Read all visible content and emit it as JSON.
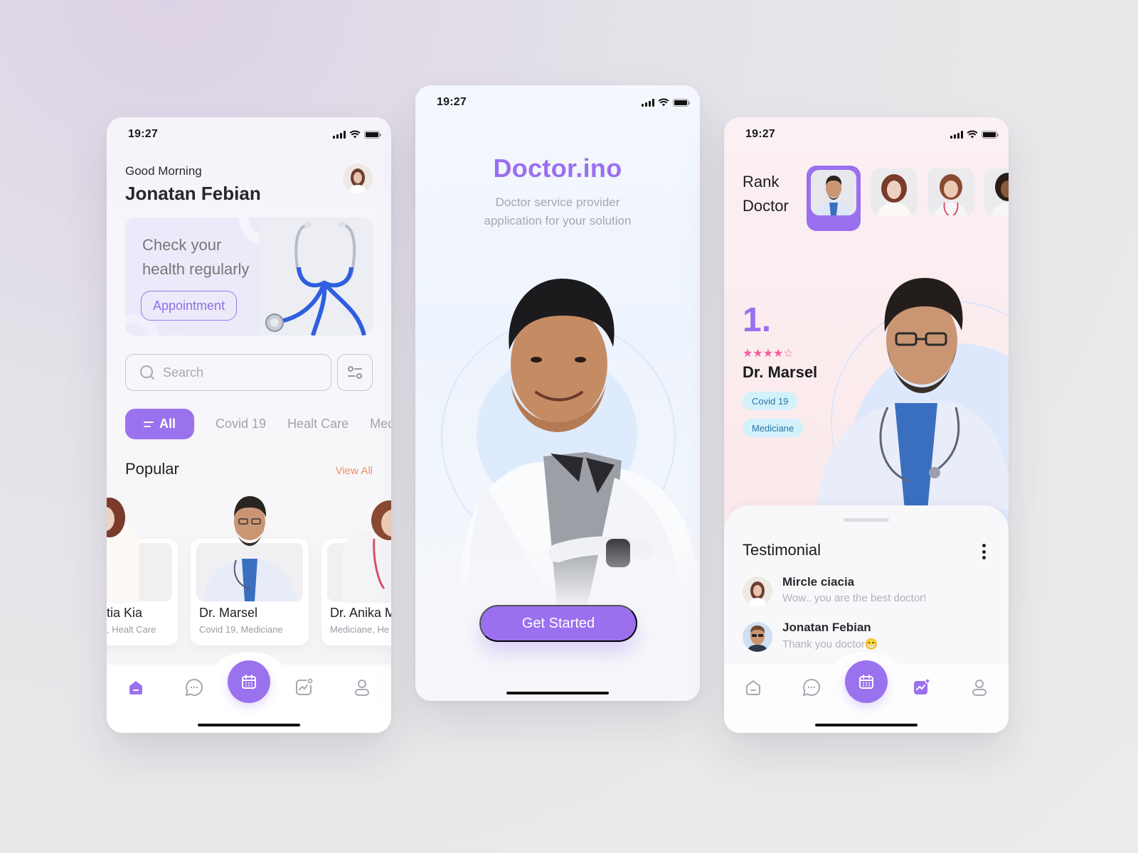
{
  "status_bar": {
    "time": "19:27"
  },
  "colors": {
    "accent": "#9B72EE",
    "view_all": "#F09060",
    "star": "#F2609E",
    "tag_bg": "#D3F1FB",
    "tag_text": "#2874A6"
  },
  "home_screen": {
    "greeting": "Good Morning",
    "user_name": "Jonatan Febian",
    "avatar_icon": "user-avatar",
    "banner": {
      "line1": "Check your",
      "line2": "health regularly",
      "button": "Appointment"
    },
    "search": {
      "placeholder": "Search",
      "icon": "search-icon",
      "filter_icon": "filter-icon"
    },
    "categories": [
      {
        "label": "All",
        "active": true,
        "icon": "list-icon"
      },
      {
        "label": "Covid 19",
        "active": false
      },
      {
        "label": "Healt Care",
        "active": false
      },
      {
        "label": "Mec",
        "active": false
      }
    ],
    "popular": {
      "title": "Popular",
      "view_all": "View All",
      "doctors": [
        {
          "name": "tia Kia",
          "specialty": ", Healt Care"
        },
        {
          "name": "Dr. Marsel",
          "specialty": "Covid 19, Mediciane"
        },
        {
          "name": "Dr. Anika M",
          "specialty": "Mediciane, He"
        }
      ]
    },
    "nav": {
      "active": "home",
      "items": [
        "home-icon",
        "chat-icon",
        "calendar-icon",
        "activity-icon",
        "profile-icon"
      ]
    }
  },
  "splash_screen": {
    "brand": "Doctor.ino",
    "tagline_line1": "Doctor service provider",
    "tagline_line2": "application for your solution",
    "cta": "Get Started"
  },
  "rank_screen": {
    "title_line1": "Rank",
    "title_line2": "Doctor",
    "rank_number": "1.",
    "rating": 4.5,
    "rating_max": 5,
    "stars": "★★★★☆",
    "doctor_name": "Dr. Marsel",
    "tags": [
      "Covid 19",
      "Mediciane"
    ],
    "testimonial": {
      "title": "Testimonial",
      "reviews": [
        {
          "name": "Mircle ciacia",
          "text": "Wow.. you are the best doctor!"
        },
        {
          "name": "Jonatan Febian",
          "text": "Thank you doctor😁"
        }
      ]
    },
    "nav": {
      "active": "activity",
      "items": [
        "home-icon",
        "chat-icon",
        "calendar-icon",
        "activity-icon",
        "profile-icon"
      ]
    }
  }
}
